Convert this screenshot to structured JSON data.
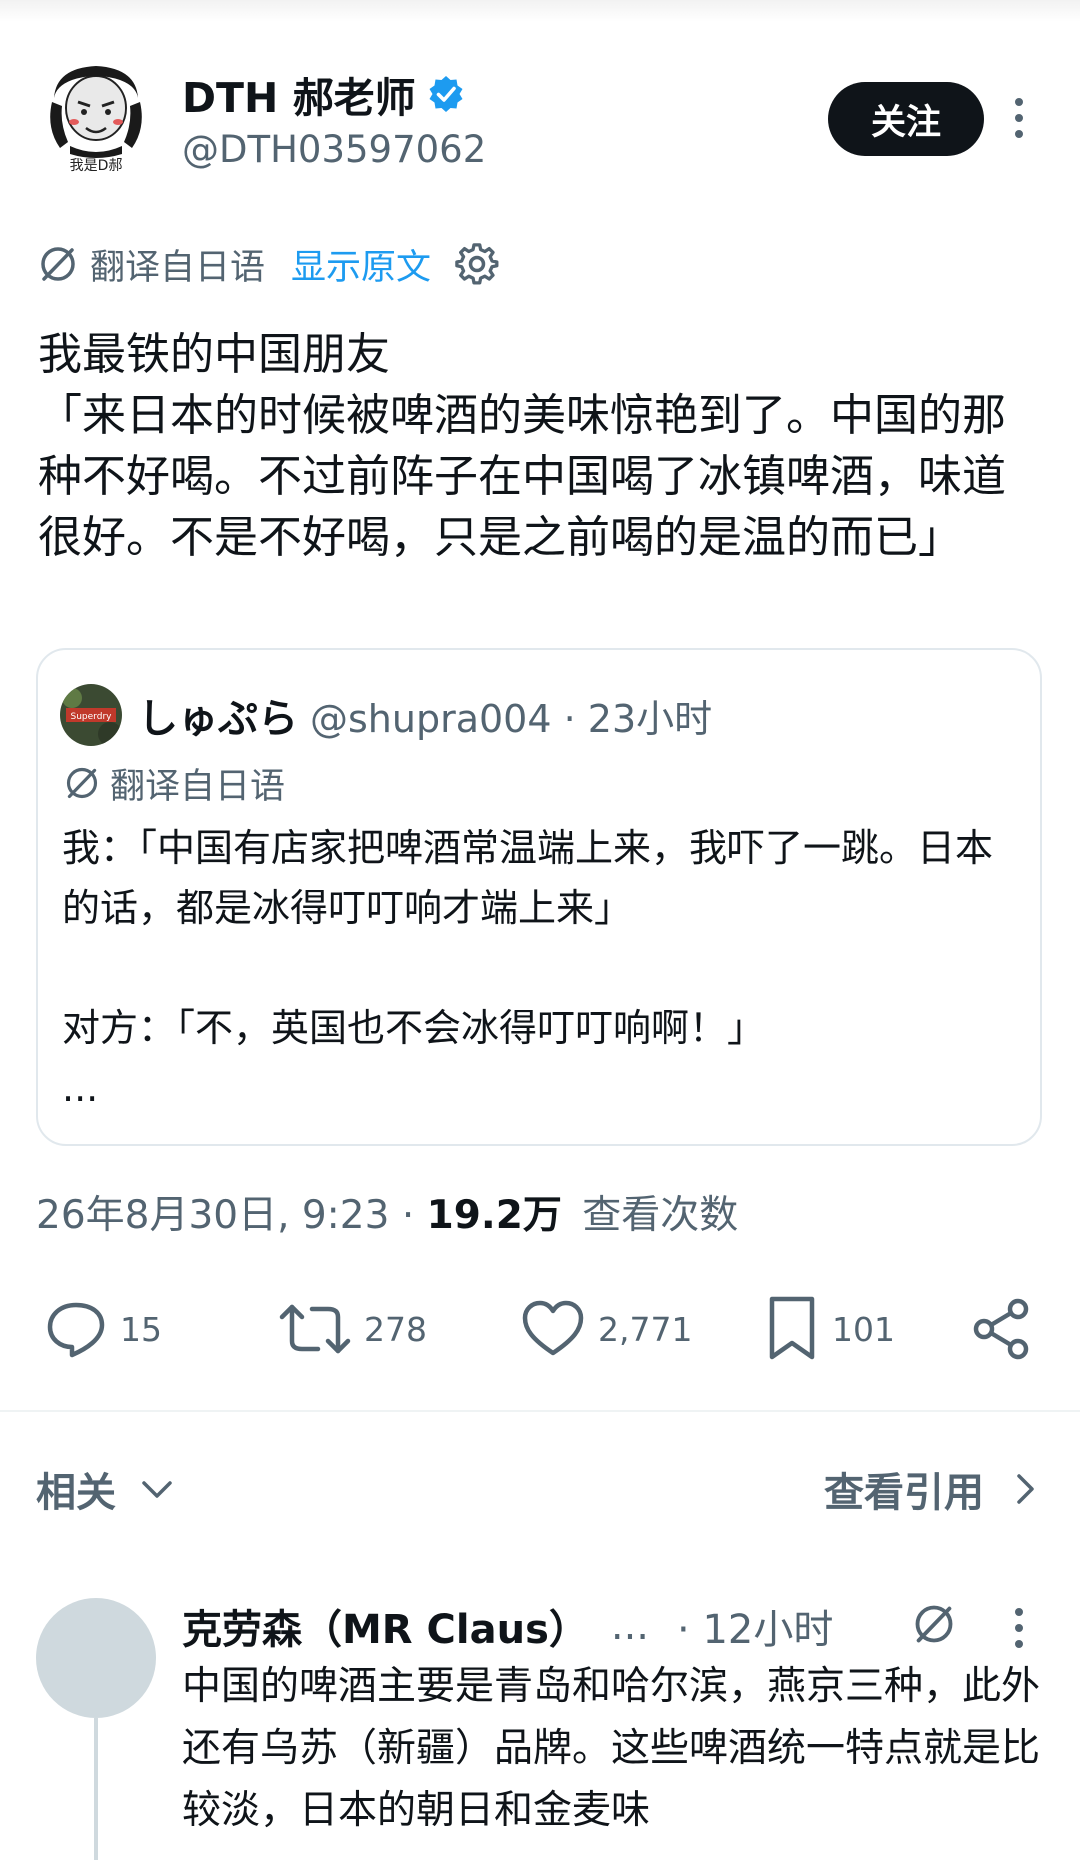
{
  "tweet": {
    "display_name": "DTH 郝老师",
    "handle": "@DTH03597062",
    "avatar_caption": "我是D郝",
    "follow_label": "关注",
    "translated_from": "翻译自日语",
    "show_original": "显示原文",
    "body": "我最铁的中国朋友\n「来日本的时候被啤酒的美味惊艳到了。中国的那种不好喝。不过前阵子在中国喝了冰镇啤酒，味道很好。不是不好喝，只是之前喝的是温的而已」",
    "timestamp": "26年8月30日, 9:23",
    "views_count": "19.2万",
    "views_label": "查看次数"
  },
  "quote": {
    "display_name": "しゅぷら",
    "meta": "@shupra004 · 23小时",
    "translated_from": "翻译自日语",
    "body": "我：「中国有店家把啤酒常温端上来，我吓了一跳。日本的话，都是冰得叮叮响才端上来」\n\n对方：「不，英国也不会冰得叮叮响啊！」\n...",
    "avatar_text": "Superdry"
  },
  "actions": {
    "replies": "15",
    "retweets": "278",
    "likes": "2,771",
    "bookmarks": "101"
  },
  "related": {
    "label": "相关",
    "view_quotes": "查看引用"
  },
  "reply": {
    "display_name": "克劳森（MR Claus）",
    "ellipsis": "...",
    "time": "· 12小时",
    "body": "中国的啤酒主要是青岛和哈尔滨，燕京三种，此外还有乌苏（新疆）品牌。这些啤酒统一特点就是比较淡，日本的朝日和金麦味"
  },
  "colors": {
    "primary_text": "#0f1419",
    "secondary_text": "#536471",
    "link": "#1d9bf0",
    "verified": "#1d9bf0",
    "follow_button_bg": "#0f1419",
    "border": "#e1e8ed"
  },
  "icons": [
    "verified-badge-icon",
    "more-options-icon",
    "translate-icon",
    "settings-gear-icon",
    "reply-icon",
    "retweet-icon",
    "like-heart-icon",
    "bookmark-icon",
    "share-icon",
    "chevron-down-icon",
    "chevron-right-icon"
  ]
}
